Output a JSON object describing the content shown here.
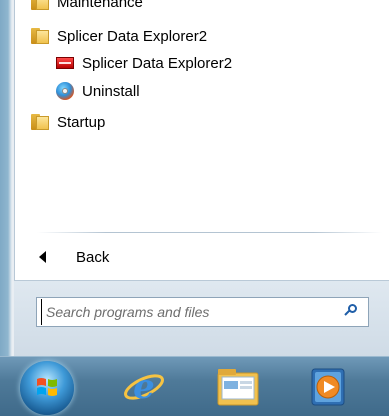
{
  "start_menu": {
    "items": [
      {
        "label": "Maintenance",
        "icon": "folder-icon"
      },
      {
        "label": "Splicer Data Explorer2",
        "icon": "folder-icon"
      },
      {
        "label": "Splicer Data Explorer2",
        "icon": "app-icon"
      },
      {
        "label": "Uninstall",
        "icon": "uninstall-icon"
      },
      {
        "label": "Startup",
        "icon": "folder-icon"
      }
    ],
    "back_label": "Back",
    "search": {
      "placeholder": "Search programs and files",
      "value": ""
    }
  },
  "taskbar": {
    "pinned": [
      "start-orb-icon",
      "internet-explorer-icon",
      "windows-explorer-icon",
      "media-player-icon"
    ]
  }
}
